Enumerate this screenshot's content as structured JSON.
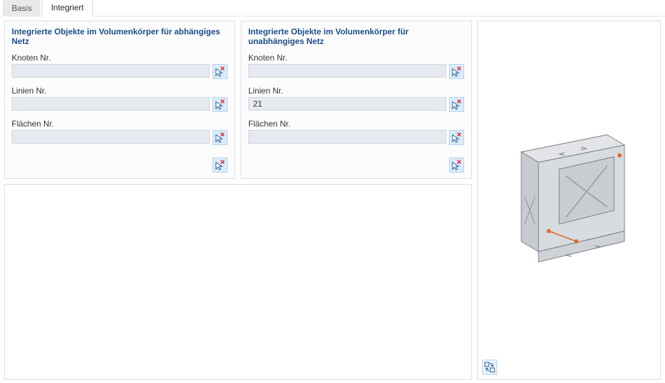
{
  "tabs": {
    "basis": "Basis",
    "integriert": "Integriert",
    "active": "integriert"
  },
  "left_panel": {
    "title": "Integrierte Objekte im Volumenkörper für abhängiges Netz",
    "knoten_label": "Knoten Nr.",
    "knoten_value": "",
    "linien_label": "Linien Nr.",
    "linien_value": "",
    "flaechen_label": "Flächen Nr.",
    "flaechen_value": ""
  },
  "right_panel": {
    "title": "Integrierte Objekte im Volumenkörper für unabhängiges Netz",
    "knoten_label": "Knoten Nr.",
    "knoten_value": "",
    "linien_label": "Linien Nr.",
    "linien_value": "21",
    "flaechen_label": "Flächen Nr.",
    "flaechen_value": ""
  },
  "icons": {
    "pick": "pick-cursor-icon",
    "swap": "swap-icon"
  }
}
